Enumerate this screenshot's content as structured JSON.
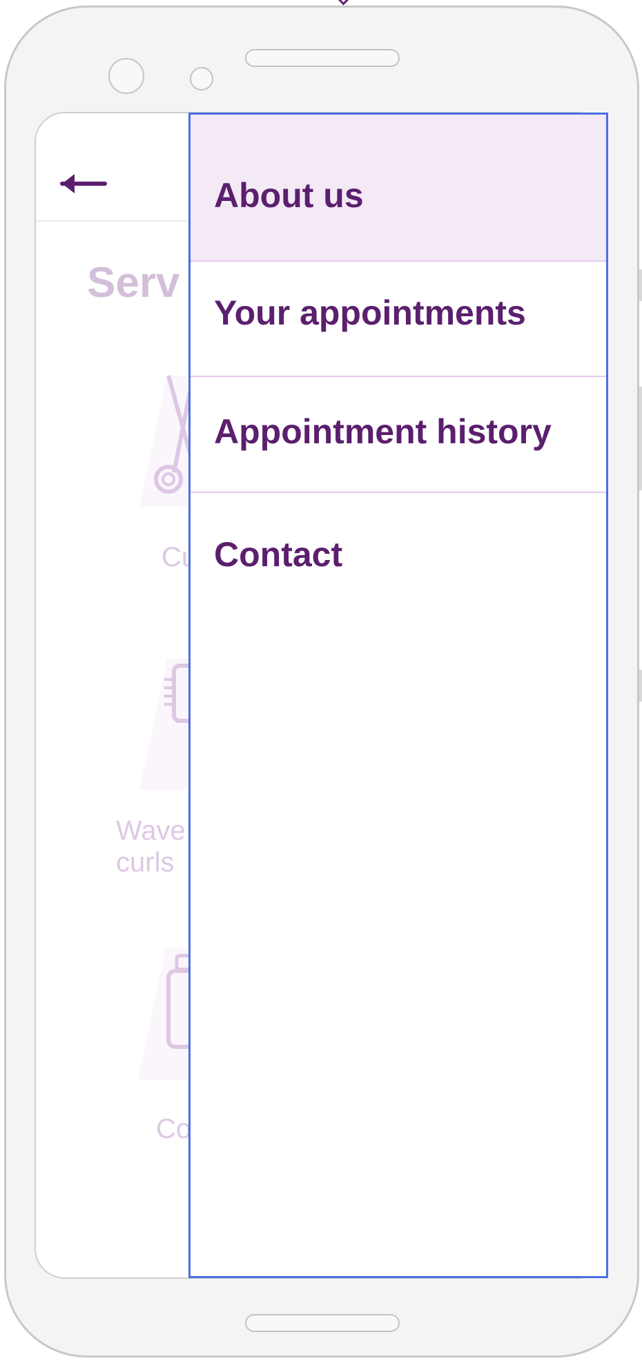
{
  "colors": {
    "accent": "#5b1f6e",
    "drawer_border": "#4a6fe0",
    "active_item_bg": "#f3eaf6",
    "divider": "#e2cbe8",
    "dimmed_text": "#9b55ad"
  },
  "header": {
    "back_icon": "arrow-left-icon"
  },
  "background_page": {
    "title": "Serv",
    "services": [
      {
        "label": "Cu",
        "icon": "scissors-icon"
      },
      {
        "label": "Wave curls",
        "icon": "brush-icon"
      },
      {
        "label": "Co",
        "icon": "spray-bottle-icon"
      }
    ]
  },
  "drawer": {
    "items": [
      {
        "label": "About us",
        "active": true
      },
      {
        "label": "Your appointments",
        "active": false
      },
      {
        "label": "Appointment history",
        "active": false
      },
      {
        "label": "Contact",
        "active": false
      }
    ]
  }
}
